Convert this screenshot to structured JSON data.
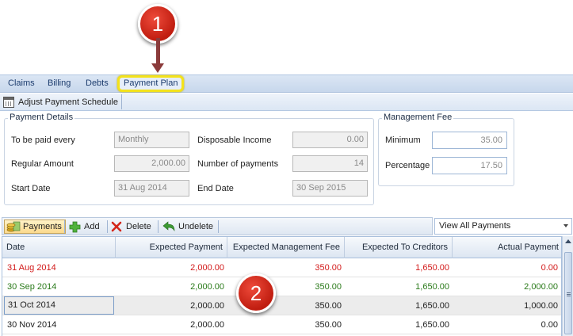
{
  "callouts": [
    "1",
    "2"
  ],
  "tabs": [
    "Claims",
    "Billing",
    "Debts",
    "Payment Plan"
  ],
  "toolbar": {
    "adjust_label": "Adjust Payment Schedule"
  },
  "payment_details": {
    "title": "Payment Details",
    "to_be_paid_label": "To be paid every",
    "to_be_paid_value": "Monthly",
    "disposable_label": "Disposable Income",
    "disposable_value": "0.00",
    "regular_label": "Regular Amount",
    "regular_value": "2,000.00",
    "num_payments_label": "Number of payments",
    "num_payments_value": "14",
    "start_label": "Start Date",
    "start_value": "31 Aug 2014",
    "end_label": "End Date",
    "end_value": "30 Sep 2015"
  },
  "management_fee": {
    "title": "Management Fee",
    "minimum_label": "Minimum",
    "minimum_value": "35.00",
    "percentage_label": "Percentage",
    "percentage_value": "17.50"
  },
  "grid_toolbar": {
    "payments_label": "Payments",
    "add_label": "Add",
    "delete_label": "Delete",
    "undelete_label": "Undelete",
    "view_label": "View All Payments"
  },
  "colors": {
    "overdue": "#d21a1a",
    "paid": "#2a7a1a",
    "normal": "#222222",
    "highlight": "#f4e21a"
  },
  "grid": {
    "columns": [
      "Date",
      "Expected Payment",
      "Expected Management Fee",
      "Expected To Creditors",
      "Actual Payment"
    ],
    "rows": [
      {
        "date": "31 Aug 2014",
        "expected_payment": "2,000.00",
        "mgmt_fee": "350.00",
        "to_creditors": "1,650.00",
        "actual": "0.00",
        "status": "overdue"
      },
      {
        "date": "30 Sep 2014",
        "expected_payment": "2,000.00",
        "mgmt_fee": "350.00",
        "to_creditors": "1,650.00",
        "actual": "2,000.00",
        "status": "paid"
      },
      {
        "date": "31 Oct 2014",
        "expected_payment": "2,000.00",
        "mgmt_fee": "350.00",
        "to_creditors": "1,650.00",
        "actual": "1,000.00",
        "status": "normal"
      },
      {
        "date": "30 Nov 2014",
        "expected_payment": "2,000.00",
        "mgmt_fee": "350.00",
        "to_creditors": "1,650.00",
        "actual": "0.00",
        "status": "normal"
      }
    ]
  }
}
